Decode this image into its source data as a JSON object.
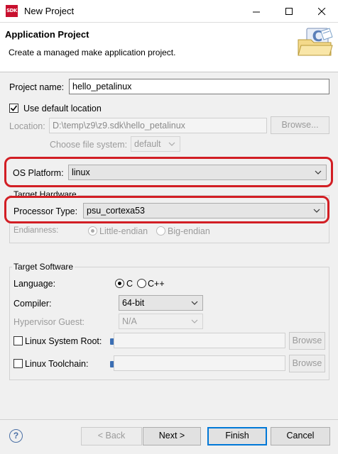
{
  "window": {
    "title": "New Project",
    "app_icon_text": "SDK"
  },
  "header": {
    "title": "Application Project",
    "description": "Create a managed make application project."
  },
  "project": {
    "name_label": "Project name:",
    "name_value": "hello_petalinux",
    "default_location_label": "Use default location",
    "default_location_checked": true,
    "location_label": "Location:",
    "location_value": "D:\\temp\\z9\\z9.sdk\\hello_petalinux",
    "browse_label": "Browse...",
    "filesystem_label": "Choose file system:",
    "filesystem_value": "default"
  },
  "os_platform": {
    "label": "OS Platform:",
    "value": "linux"
  },
  "target_hardware": {
    "legend": "Target Hardware",
    "processor_label": "Processor Type:",
    "processor_value": "psu_cortexa53",
    "endianness_label": "Endianness:",
    "little_endian": "Little-endian",
    "big_endian": "Big-endian",
    "selected": "Little-endian"
  },
  "target_software": {
    "legend": "Target Software",
    "language_label": "Language:",
    "lang_c": "C",
    "lang_cpp": "C++",
    "selected_language": "C",
    "compiler_label": "Compiler:",
    "compiler_value": "64-bit",
    "hypervisor_label": "Hypervisor Guest:",
    "hypervisor_value": "N/A",
    "sysroot_label": "Linux System Root:",
    "sysroot_value": "",
    "toolchain_label": "Linux Toolchain:",
    "toolchain_value": "",
    "browse_label": "Browse"
  },
  "footer": {
    "help_icon": "?",
    "back_label": "< Back",
    "next_label": "Next >",
    "finish_label": "Finish",
    "cancel_label": "Cancel"
  },
  "colors": {
    "highlight": "#d21e24",
    "accent": "#0078d7"
  }
}
